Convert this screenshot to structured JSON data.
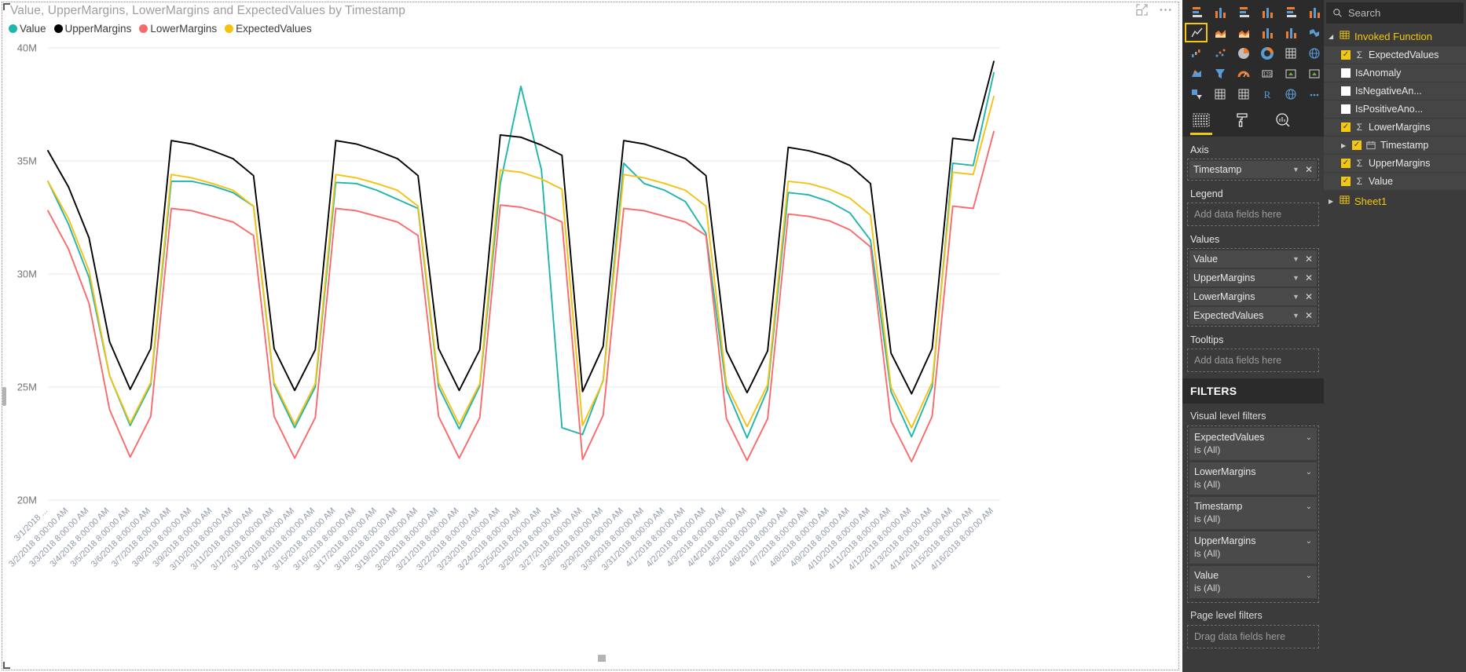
{
  "visual": {
    "title": "Value, UpperMargins, LowerMargins and ExpectedValues by Timestamp",
    "focus_icon": "focus-mode-icon",
    "more_icon": "more-options-icon"
  },
  "legend": [
    {
      "label": "Value",
      "color": "#1fb5ad"
    },
    {
      "label": "UpperMargins",
      "color": "#000000"
    },
    {
      "label": "LowerMargins",
      "color": "#fb6a6a"
    },
    {
      "label": "ExpectedValues",
      "color": "#f5c211"
    }
  ],
  "chart_data": {
    "type": "line",
    "title": "Value, UpperMargins, LowerMargins and ExpectedValues by Timestamp",
    "xlabel": "Timestamp",
    "ylabel": "",
    "ylim": [
      20000000,
      40000000
    ],
    "ytick_labels": [
      "40M",
      "35M",
      "30M",
      "25M",
      "20M"
    ],
    "ytick_values": [
      40000000,
      35000000,
      30000000,
      25000000,
      20000000
    ],
    "grid": true,
    "legend_position": "top-left",
    "x": [
      "3/1/2018 8:00:00 AM",
      "3/2/2018 8:00:00 AM",
      "3/3/2018 8:00:00 AM",
      "3/4/2018 8:00:00 AM",
      "3/5/2018 8:00:00 AM",
      "3/6/2018 8:00:00 AM",
      "3/7/2018 8:00:00 AM",
      "3/8/2018 8:00:00 AM",
      "3/9/2018 8:00:00 AM",
      "3/10/2018 8:00:00 AM",
      "3/11/2018 8:00:00 AM",
      "3/12/2018 8:00:00 AM",
      "3/13/2018 8:00:00 AM",
      "3/14/2018 8:00:00 AM",
      "3/15/2018 8:00:00 AM",
      "3/16/2018 8:00:00 AM",
      "3/17/2018 8:00:00 AM",
      "3/18/2018 8:00:00 AM",
      "3/19/2018 8:00:00 AM",
      "3/20/2018 8:00:00 AM",
      "3/21/2018 8:00:00 AM",
      "3/22/2018 8:00:00 AM",
      "3/23/2018 8:00:00 AM",
      "3/24/2018 8:00:00 AM",
      "3/25/2018 8:00:00 AM",
      "3/26/2018 8:00:00 AM",
      "3/27/2018 8:00:00 AM",
      "3/28/2018 8:00:00 AM",
      "3/29/2018 8:00:00 AM",
      "3/30/2018 8:00:00 AM",
      "3/31/2018 8:00:00 AM",
      "4/1/2018 8:00:00 AM",
      "4/2/2018 8:00:00 AM",
      "4/3/2018 8:00:00 AM",
      "4/4/2018 8:00:00 AM",
      "4/5/2018 8:00:00 AM",
      "4/6/2018 8:00:00 AM",
      "4/7/2018 8:00:00 AM",
      "4/8/2018 8:00:00 AM",
      "4/9/2018 8:00:00 AM",
      "4/10/2018 8:00:00 AM",
      "4/11/2018 8:00:00 AM",
      "4/12/2018 8:00:00 AM",
      "4/13/2018 8:00:00 AM",
      "4/14/2018 8:00:00 AM",
      "4/15/2018 8:00:00 AM",
      "4/16/2018 8:00:00 AM"
    ],
    "x_first_label": "3/1/2018 ...",
    "series": [
      {
        "name": "Value",
        "color": "#1fb5ad",
        "values": [
          34100000,
          32200000,
          29850000,
          25500000,
          23300000,
          25100000,
          34100000,
          34100000,
          33900000,
          33600000,
          33000000,
          25100000,
          23200000,
          25000000,
          34050000,
          34000000,
          33700000,
          33300000,
          32900000,
          25000000,
          23150000,
          25050000,
          34000000,
          38300000,
          34600000,
          23200000,
          22900000,
          25300000,
          34900000,
          34000000,
          33700000,
          33200000,
          31800000,
          24900000,
          22750000,
          24900000,
          33600000,
          33500000,
          33200000,
          32700000,
          31500000,
          24800000,
          22800000,
          25000000,
          34900000,
          34800000,
          38900000
        ]
      },
      {
        "name": "UpperMargins",
        "color": "#000000",
        "values": [
          35450000,
          33850000,
          31600000,
          27000000,
          24900000,
          26700000,
          35900000,
          35750000,
          35450000,
          35100000,
          34350000,
          26700000,
          24850000,
          26650000,
          35900000,
          35750000,
          35450000,
          35100000,
          34350000,
          26700000,
          24850000,
          26650000,
          36150000,
          36050000,
          35700000,
          35250000,
          24800000,
          26800000,
          35900000,
          35750000,
          35450000,
          35100000,
          34350000,
          26600000,
          24750000,
          26600000,
          35600000,
          35450000,
          35200000,
          34800000,
          34000000,
          26500000,
          24700000,
          26700000,
          36000000,
          35900000,
          39400000
        ]
      },
      {
        "name": "LowerMargins",
        "color": "#fb6a6a",
        "values": [
          32800000,
          31100000,
          28700000,
          24000000,
          21900000,
          23700000,
          32900000,
          32800000,
          32550000,
          32300000,
          31700000,
          23700000,
          21850000,
          23650000,
          32900000,
          32800000,
          32550000,
          32300000,
          31700000,
          23700000,
          21850000,
          23650000,
          33050000,
          32950000,
          32700000,
          32300000,
          21800000,
          23750000,
          32900000,
          32800000,
          32550000,
          32300000,
          31700000,
          23600000,
          21750000,
          23600000,
          32650000,
          32550000,
          32350000,
          31950000,
          31200000,
          23500000,
          21700000,
          23700000,
          33000000,
          32900000,
          36300000
        ]
      },
      {
        "name": "ExpectedValues",
        "color": "#f5c211",
        "values": [
          34100000,
          32450000,
          30150000,
          25500000,
          23400000,
          25200000,
          34400000,
          34250000,
          34000000,
          33700000,
          33000000,
          25200000,
          23350000,
          25150000,
          34400000,
          34250000,
          34000000,
          33700000,
          33000000,
          25200000,
          23350000,
          25150000,
          34600000,
          34500000,
          34200000,
          33750000,
          23300000,
          25250000,
          34400000,
          34250000,
          34000000,
          33700000,
          33000000,
          25100000,
          23250000,
          25100000,
          34100000,
          34000000,
          33750000,
          33350000,
          32600000,
          25000000,
          23200000,
          25200000,
          34500000,
          34400000,
          37850000
        ]
      }
    ]
  },
  "viz_pane": {
    "icons": [
      "stacked-bar-chart-icon",
      "stacked-column-chart-icon",
      "clustered-bar-chart-icon",
      "clustered-column-chart-icon",
      "100-stacked-bar-chart-icon",
      "100-stacked-column-chart-icon",
      "line-chart-icon",
      "area-chart-icon",
      "stacked-area-chart-icon",
      "line-stacked-column-chart-icon",
      "line-clustered-column-chart-icon",
      "ribbon-chart-icon",
      "waterfall-chart-icon",
      "scatter-chart-icon",
      "pie-chart-icon",
      "donut-chart-icon",
      "treemap-icon",
      "map-icon",
      "filled-map-icon",
      "funnel-icon",
      "gauge-icon",
      "card-icon",
      "multi-row-card-icon",
      "kpi-icon",
      "slicer-icon",
      "table-icon",
      "matrix-icon",
      "r-script-visual-icon",
      "arcgis-map-icon",
      "more-visuals-icon"
    ],
    "selected_icon": "line-chart-icon",
    "tabs": [
      {
        "name": "fields-tab",
        "icon": "fields-grid-icon",
        "active": true
      },
      {
        "name": "format-tab",
        "icon": "paint-roller-icon",
        "active": false
      },
      {
        "name": "analytics-tab",
        "icon": "magnifier-chart-icon",
        "active": false
      }
    ],
    "wells": [
      {
        "label": "Axis",
        "placeholder": null,
        "chips": [
          "Timestamp"
        ]
      },
      {
        "label": "Legend",
        "placeholder": "Add data fields here",
        "chips": []
      },
      {
        "label": "Values",
        "placeholder": null,
        "chips": [
          "Value",
          "UpperMargins",
          "LowerMargins",
          "ExpectedValues"
        ]
      },
      {
        "label": "Tooltips",
        "placeholder": "Add data fields here",
        "chips": []
      }
    ],
    "filters": {
      "title": "FILTERS",
      "visual_level_label": "Visual level filters",
      "visual_level": [
        {
          "name": "ExpectedValues",
          "state": "is (All)"
        },
        {
          "name": "LowerMargins",
          "state": "is (All)"
        },
        {
          "name": "Timestamp",
          "state": "is (All)"
        },
        {
          "name": "UpperMargins",
          "state": "is (All)"
        },
        {
          "name": "Value",
          "state": "is (All)"
        }
      ],
      "page_level_label": "Page level filters",
      "page_level_placeholder": "Drag data fields here"
    }
  },
  "fields_pane": {
    "search_placeholder": "Search",
    "tables": [
      {
        "name": "Invoked Function",
        "expanded": true,
        "fields": [
          {
            "label": "ExpectedValues",
            "checked": true,
            "kind": "measure"
          },
          {
            "label": "IsAnomaly",
            "checked": false,
            "kind": "plain"
          },
          {
            "label": "IsNegativeAn...",
            "checked": false,
            "kind": "plain"
          },
          {
            "label": "IsPositiveAno...",
            "checked": false,
            "kind": "plain"
          },
          {
            "label": "LowerMargins",
            "checked": true,
            "kind": "measure"
          },
          {
            "label": "Timestamp",
            "checked": true,
            "kind": "date"
          },
          {
            "label": "UpperMargins",
            "checked": true,
            "kind": "measure"
          },
          {
            "label": "Value",
            "checked": true,
            "kind": "measure"
          }
        ]
      },
      {
        "name": "Sheet1",
        "expanded": false,
        "fields": []
      }
    ]
  }
}
